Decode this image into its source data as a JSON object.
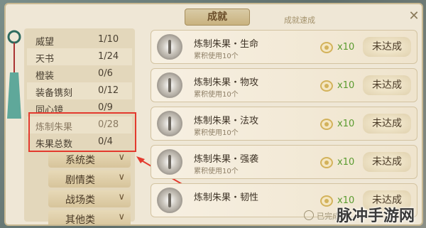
{
  "header": {
    "title": "成就",
    "subtitle": "成就速成"
  },
  "categories": [
    {
      "name": "威望",
      "value": "1/10"
    },
    {
      "name": "天书",
      "value": "1/24"
    },
    {
      "name": "橙装",
      "value": "0/6"
    },
    {
      "name": "装备镌刻",
      "value": "0/12"
    },
    {
      "name": "同心镜",
      "value": "0/9"
    },
    {
      "name": "炼制朱果",
      "value": "0/28"
    },
    {
      "name": "朱果总数",
      "value": "0/4"
    }
  ],
  "groups": [
    {
      "name": "系统类"
    },
    {
      "name": "剧情类"
    },
    {
      "name": "战场类"
    },
    {
      "name": "其他类"
    }
  ],
  "achievements": [
    {
      "title": "炼制朱果・生命",
      "desc": "累积使用10个",
      "reward": "x10",
      "status": "未达成"
    },
    {
      "title": "炼制朱果・物攻",
      "desc": "累积使用10个",
      "reward": "x10",
      "status": "未达成"
    },
    {
      "title": "炼制朱果・法攻",
      "desc": "累积使用10个",
      "reward": "x10",
      "status": "未达成"
    },
    {
      "title": "炼制朱果・强袭",
      "desc": "累积使用10个",
      "reward": "x10",
      "status": "未达成"
    },
    {
      "title": "炼制朱果・韧性",
      "desc": "",
      "reward": "x10",
      "status": "未达成"
    }
  ],
  "footer": {
    "done_label": "已完成"
  },
  "watermark": "脉冲手游网",
  "colors": {
    "highlight_box": "#e33a2e",
    "reward_green": "#5a9b2f"
  }
}
